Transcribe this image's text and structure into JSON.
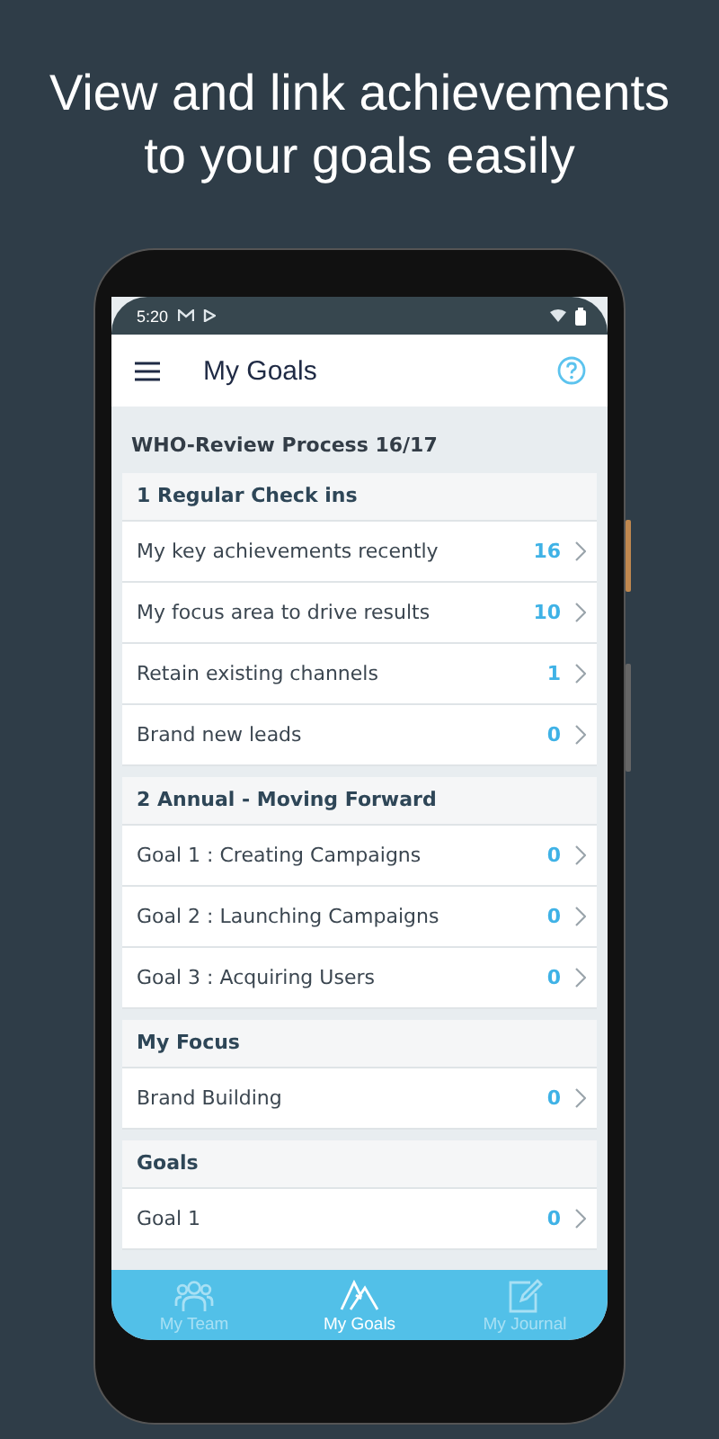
{
  "headline": "View and link achievements to your goals easily",
  "status_bar": {
    "time": "5:20"
  },
  "app_bar": {
    "title": "My Goals"
  },
  "page_title": "WHO-Review Process 16/17",
  "sections": [
    {
      "title": "1 Regular Check ins",
      "items": [
        {
          "label": "My key achievements recently",
          "count": "16"
        },
        {
          "label": "My focus area to drive results",
          "count": "10"
        },
        {
          "label": "Retain existing channels",
          "count": "1"
        },
        {
          "label": "Brand new leads",
          "count": "0"
        }
      ]
    },
    {
      "title": "2 Annual - Moving Forward",
      "items": [
        {
          "label": "Goal 1 : Creating Campaigns",
          "count": "0"
        },
        {
          "label": "Goal 2 : Launching Campaigns",
          "count": "0"
        },
        {
          "label": "Goal 3 : Acquiring Users",
          "count": "0"
        }
      ]
    },
    {
      "title": "My Focus",
      "items": [
        {
          "label": "Brand Building",
          "count": "0"
        }
      ]
    },
    {
      "title": "Goals",
      "items": [
        {
          "label": "Goal 1",
          "count": "0"
        }
      ]
    }
  ],
  "tabs": [
    {
      "label": "My Team",
      "kind": "team",
      "selected": false
    },
    {
      "label": "My Goals",
      "kind": "goals",
      "selected": true
    },
    {
      "label": "My Journal",
      "kind": "journal",
      "selected": false
    }
  ]
}
